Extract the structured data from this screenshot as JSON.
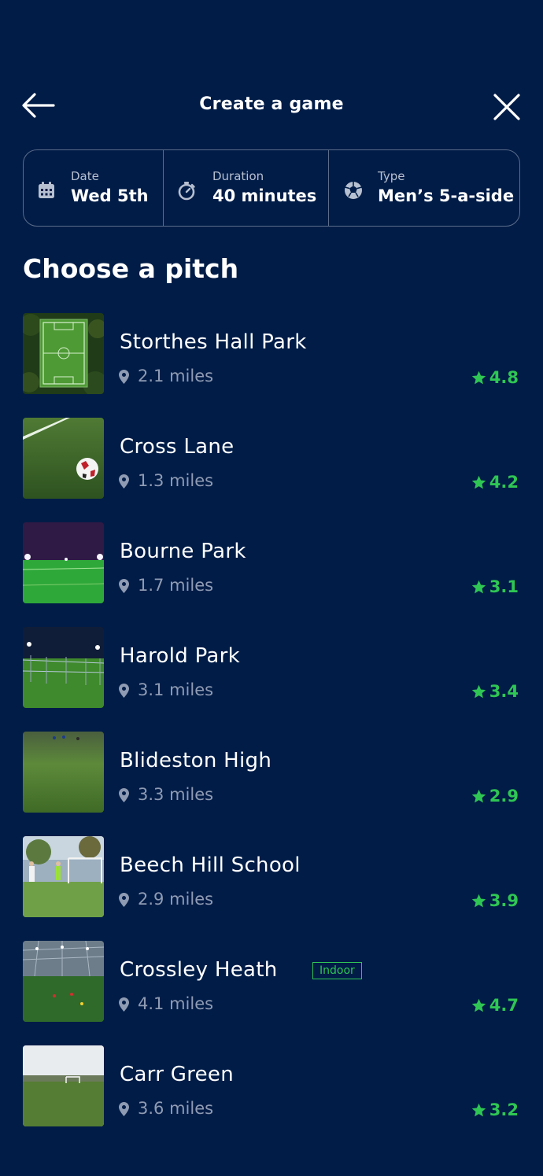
{
  "header": {
    "title": "Create a game"
  },
  "filters": {
    "date": {
      "label": "Date",
      "value": "Wed 5th"
    },
    "duration": {
      "label": "Duration",
      "value": "40 minutes"
    },
    "type": {
      "label": "Type",
      "value": "Men’s 5-a-side"
    }
  },
  "section_title": "Choose a pitch",
  "pitches": [
    {
      "name": "Storthes Hall Park",
      "distance": "2.1 miles",
      "rating": "4.8"
    },
    {
      "name": "Cross Lane",
      "distance": "1.3 miles",
      "rating": "4.2"
    },
    {
      "name": "Bourne Park",
      "distance": "1.7 miles",
      "rating": "3.1"
    },
    {
      "name": "Harold Park",
      "distance": "3.1 miles",
      "rating": "3.4"
    },
    {
      "name": "Blideston High",
      "distance": "3.3 miles",
      "rating": "2.9"
    },
    {
      "name": "Beech Hill School",
      "distance": "2.9 miles",
      "rating": "3.9"
    },
    {
      "name": "Crossley Heath",
      "distance": "4.1 miles",
      "rating": "4.7",
      "badge": "Indoor"
    },
    {
      "name": "Carr Green",
      "distance": "3.6 miles",
      "rating": "3.2"
    }
  ],
  "colors": {
    "background": "#001c47",
    "accent": "#2fc654",
    "muted": "#8f9bb3",
    "border": "#5b6d8a"
  },
  "icons": {
    "back": "arrow-left-icon",
    "close": "close-icon",
    "date": "calendar-icon",
    "duration": "stopwatch-icon",
    "type": "football-icon",
    "distance": "map-pin-icon",
    "rating": "star-icon"
  }
}
